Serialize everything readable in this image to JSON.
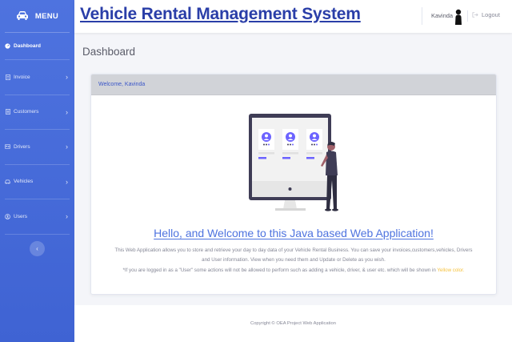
{
  "sidebar": {
    "menu_label": "MENU",
    "brand_icon": "car-icon",
    "items": [
      {
        "label": "Dashboard",
        "icon": "dashboard-icon"
      },
      {
        "label": "Invoice",
        "icon": "invoice-icon"
      },
      {
        "label": "Customers",
        "icon": "customers-icon"
      },
      {
        "label": "Drivers",
        "icon": "drivers-icon"
      },
      {
        "label": "Vehicles",
        "icon": "vehicles-icon"
      },
      {
        "label": "Users",
        "icon": "users-icon"
      }
    ],
    "collapse_glyph": "‹"
  },
  "header": {
    "title": "Vehicle Rental Management System",
    "username": "Kavinda",
    "logout_label": "Logout"
  },
  "main": {
    "page_title": "Dashboard",
    "card_header": "Welcome, Kavinda",
    "welcome_heading": "Hello, and Welcome to this Java based Web Application!",
    "description_line1": "This Web Application allows you to store and retrieve your day to day data of your Vehicle Rental Business. You can save your invoices,customers,vehicles, Drivers",
    "description_line2": "and User information. View when you need them and Update or Delete as you wish.",
    "note_text": "*If you are logged in as a \"User\" some actions will not be allowed to perform such as adding a vehicle, driver, & user etc. which will be shown in ",
    "note_highlight": "Yellow color."
  },
  "footer": {
    "copyright": "Copyright © OEA Project Web Application"
  },
  "colors": {
    "sidebar": "#4e73df",
    "title": "#2a3ea8",
    "accent": "#4e73df",
    "highlight": "#f6c23e"
  }
}
